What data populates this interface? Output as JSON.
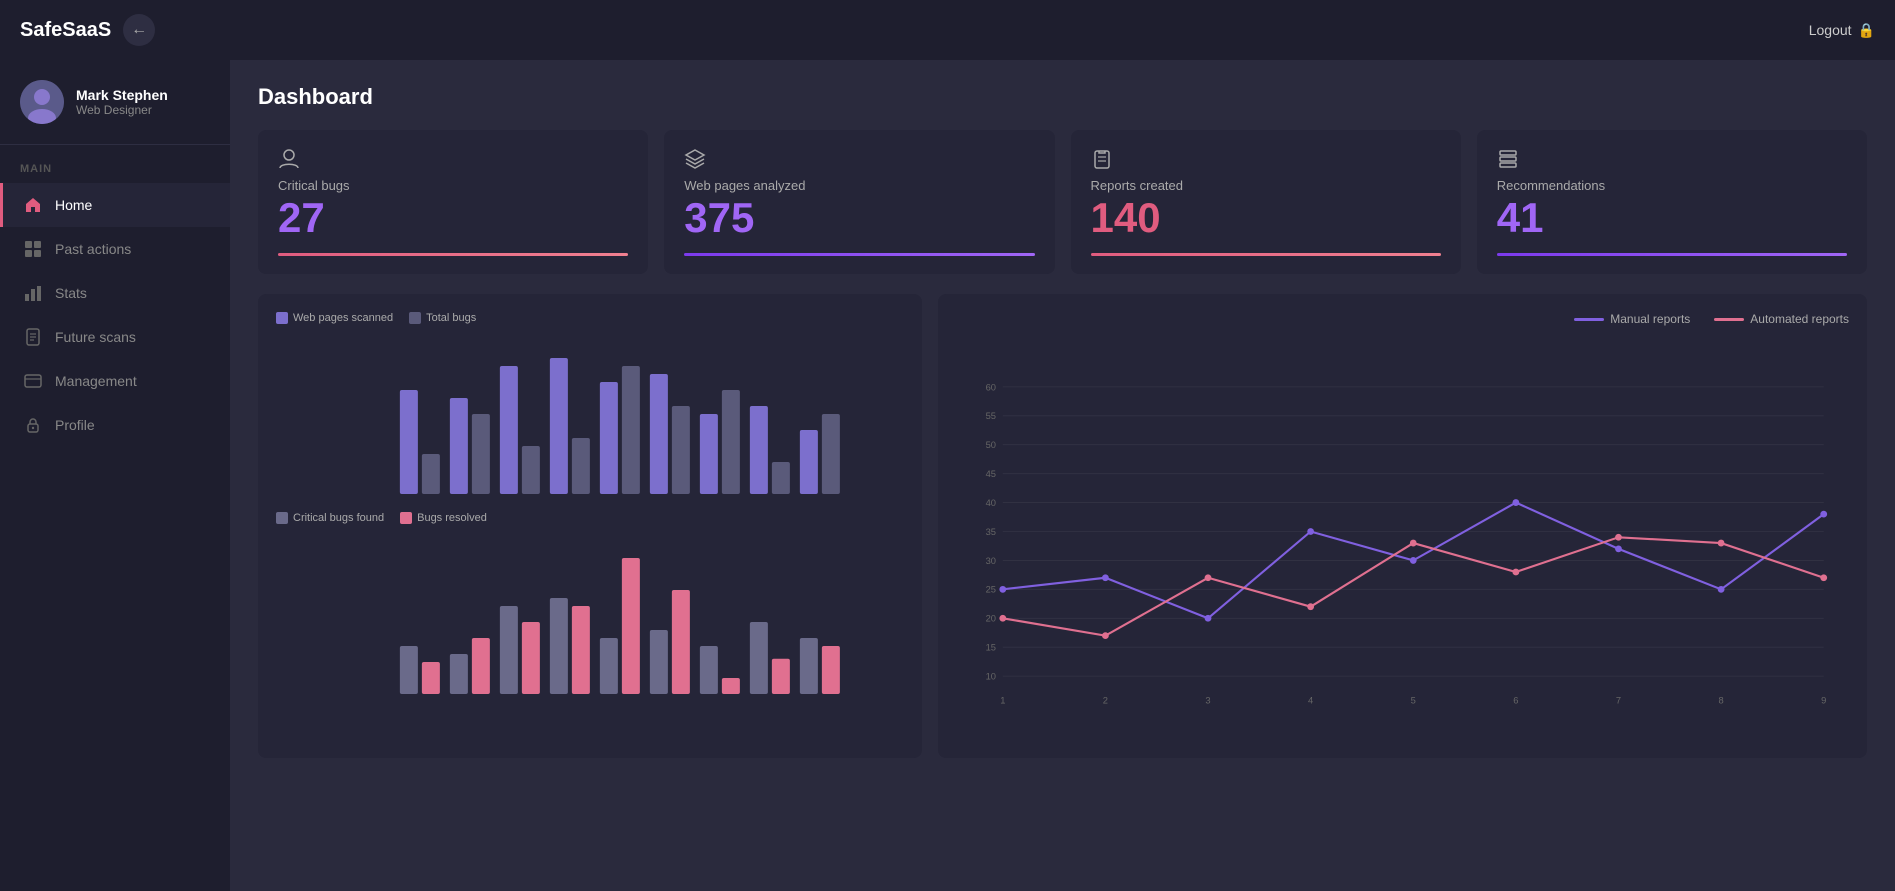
{
  "brand": "SafeSaaS",
  "topbar": {
    "back_label": "←",
    "logout_label": "Logout"
  },
  "sidebar": {
    "user_name": "Mark Stephen",
    "user_role": "Web Designer",
    "section_label": "MAIN",
    "nav_items": [
      {
        "id": "home",
        "label": "Home",
        "icon": "home",
        "active": true
      },
      {
        "id": "past-actions",
        "label": "Past actions",
        "icon": "grid",
        "active": false
      },
      {
        "id": "stats",
        "label": "Stats",
        "icon": "chart",
        "active": false
      },
      {
        "id": "future-scans",
        "label": "Future scans",
        "icon": "document",
        "active": false
      },
      {
        "id": "management",
        "label": "Management",
        "icon": "card",
        "active": false
      },
      {
        "id": "profile",
        "label": "Profile",
        "icon": "lock",
        "active": false
      }
    ]
  },
  "dashboard": {
    "title": "Dashboard",
    "stat_cards": [
      {
        "id": "critical-bugs",
        "label": "Critical bugs",
        "value": "27",
        "color": "purple",
        "bar": "pink"
      },
      {
        "id": "web-pages",
        "label": "Web pages analyzed",
        "value": "375",
        "color": "purple",
        "bar": "purple"
      },
      {
        "id": "reports",
        "label": "Reports created",
        "value": "140",
        "color": "pink",
        "bar": "pink"
      },
      {
        "id": "recommendations",
        "label": "Recommendations",
        "value": "41",
        "color": "purple",
        "bar": "purple"
      }
    ],
    "bar_chart_top": {
      "legend": [
        {
          "label": "Web pages scanned",
          "color": "#7c6fcd"
        },
        {
          "label": "Total bugs",
          "color": "#5a5a7a"
        }
      ],
      "bars": [
        {
          "web": 65,
          "bugs": 25
        },
        {
          "web": 60,
          "bugs": 50
        },
        {
          "web": 80,
          "bugs": 30
        },
        {
          "web": 85,
          "bugs": 35
        },
        {
          "web": 70,
          "bugs": 80
        },
        {
          "web": 75,
          "bugs": 55
        },
        {
          "web": 50,
          "bugs": 65
        },
        {
          "web": 55,
          "bugs": 20
        },
        {
          "web": 40,
          "bugs": 50
        }
      ]
    },
    "bar_chart_bottom": {
      "legend": [
        {
          "label": "Critical bugs found",
          "color": "#6a6a8a"
        },
        {
          "label": "Bugs resolved",
          "color": "#e07090"
        }
      ],
      "bars": [
        {
          "critical": 30,
          "resolved": 20
        },
        {
          "critical": 25,
          "resolved": 35
        },
        {
          "critical": 55,
          "resolved": 45
        },
        {
          "critical": 60,
          "resolved": 55
        },
        {
          "critical": 35,
          "resolved": 85
        },
        {
          "critical": 40,
          "resolved": 65
        },
        {
          "critical": 30,
          "resolved": 10
        },
        {
          "critical": 45,
          "resolved": 22
        },
        {
          "critical": 35,
          "resolved": 30
        }
      ]
    },
    "line_chart": {
      "legend": [
        {
          "label": "Manual reports",
          "color": "#8060e0"
        },
        {
          "label": "Automated reports",
          "color": "#e07090"
        }
      ],
      "y_labels": [
        "10",
        "15",
        "20",
        "25",
        "30",
        "35",
        "40",
        "45",
        "50",
        "55",
        "60"
      ],
      "x_labels": [
        "1",
        "2",
        "3",
        "4",
        "5",
        "6",
        "7",
        "8",
        "9"
      ],
      "manual": [
        25,
        27,
        20,
        35,
        30,
        40,
        32,
        25,
        38
      ],
      "automated": [
        20,
        17,
        27,
        22,
        33,
        28,
        34,
        33,
        27
      ]
    }
  }
}
